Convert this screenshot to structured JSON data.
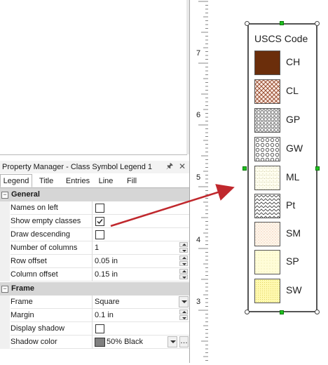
{
  "property_manager": {
    "title": "Property Manager - Class Symbol Legend 1",
    "tabs": [
      {
        "label": "Legend",
        "active": true
      },
      {
        "label": "Title",
        "active": false
      },
      {
        "label": "Entries",
        "active": false
      },
      {
        "label": "Line",
        "active": false
      },
      {
        "label": "Fill",
        "active": false
      }
    ],
    "sections": {
      "general": {
        "label": "General",
        "collapse": "−",
        "names_on_left": {
          "label": "Names on left",
          "checked": false
        },
        "show_empty_classes": {
          "label": "Show empty classes",
          "checked": true
        },
        "draw_descending": {
          "label": "Draw descending",
          "checked": false
        },
        "number_of_columns": {
          "label": "Number of columns",
          "value": "1"
        },
        "row_offset": {
          "label": "Row offset",
          "value": "0.05 in"
        },
        "column_offset": {
          "label": "Column offset",
          "value": "0.15 in"
        }
      },
      "frame": {
        "label": "Frame",
        "collapse": "−",
        "frame": {
          "label": "Frame",
          "value": "Square"
        },
        "margin": {
          "label": "Margin",
          "value": "0.1 in"
        },
        "display_shadow": {
          "label": "Display shadow",
          "checked": false
        },
        "shadow_color": {
          "label": "Shadow color",
          "value": "50% Black",
          "color": "#808080"
        }
      }
    }
  },
  "ruler": {
    "labels": [
      "7",
      "6",
      "5",
      "4",
      "3"
    ]
  },
  "legend": {
    "title": "USCS Code",
    "entries": [
      {
        "label": "CH",
        "pattern": "solid-brown"
      },
      {
        "label": "CL",
        "pattern": "crosshatch"
      },
      {
        "label": "GP",
        "pattern": "gravel-dense"
      },
      {
        "label": "GW",
        "pattern": "gravel-circles"
      },
      {
        "label": "ML",
        "pattern": "silt-dots"
      },
      {
        "label": "Pt",
        "pattern": "zigzag"
      },
      {
        "label": "SM",
        "pattern": "sand-dots"
      },
      {
        "label": "SP",
        "pattern": "sand-fine"
      },
      {
        "label": "SW",
        "pattern": "sand-yellow"
      }
    ]
  },
  "colors": {
    "arrow": "#c0282d",
    "handle": "#1fc01f",
    "ch_fill": "#6b2e0b"
  }
}
